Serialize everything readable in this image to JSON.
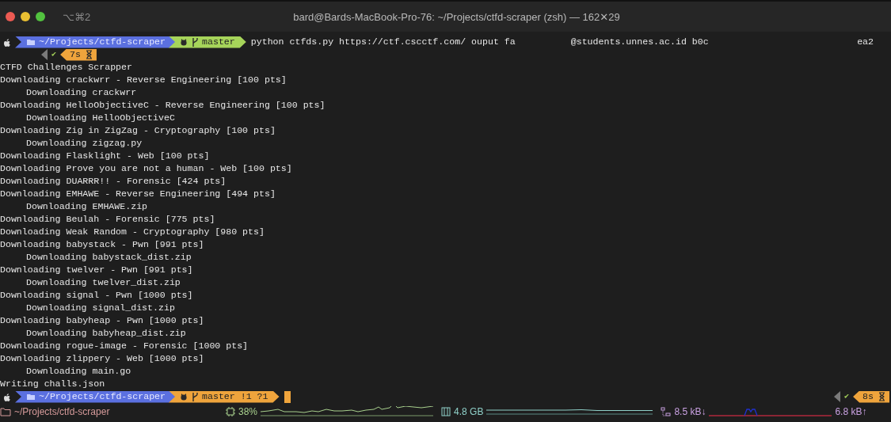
{
  "window": {
    "title": "bard@Bards-MacBook-Pro-76: ~/Projects/ctfd-scraper (zsh) — 162✕29",
    "shortcut": "⌥⌘2"
  },
  "prompt": {
    "path": "~/Projects/ctfd-scraper",
    "branch": "master",
    "dirty": false,
    "command": [
      "python ctfds.py https://ctf.cscctf.com/ ouput fa",
      "@students.unnes.ac.id b0c",
      "ea2"
    ]
  },
  "right_prompt": {
    "status": "✔",
    "duration": "7s"
  },
  "output": [
    {
      "kind": "line",
      "text": "CTFD Challenges Scrapper"
    },
    {
      "kind": "line",
      "text": "Downloading crackwrr - Reverse Engineering [100 pts]"
    },
    {
      "kind": "file",
      "text": "Downloading crackwrr"
    },
    {
      "kind": "line",
      "text": "Downloading HelloObjectiveC - Reverse Engineering [100 pts]"
    },
    {
      "kind": "file",
      "text": "Downloading HelloObjectiveC"
    },
    {
      "kind": "line",
      "text": "Downloading Zig in ZigZag - Cryptography [100 pts]"
    },
    {
      "kind": "file",
      "text": "Downloading zigzag.py"
    },
    {
      "kind": "line",
      "text": "Downloading Flasklight - Web [100 pts]"
    },
    {
      "kind": "line",
      "text": "Downloading Prove you are not a human - Web [100 pts]"
    },
    {
      "kind": "line",
      "text": "Downloading DUARRR!! - Forensic [424 pts]"
    },
    {
      "kind": "line",
      "text": "Downloading EMHAWE - Reverse Engineering [494 pts]"
    },
    {
      "kind": "file",
      "text": "Downloading EMHAWE.zip"
    },
    {
      "kind": "line",
      "text": "Downloading Beulah - Forensic [775 pts]"
    },
    {
      "kind": "line",
      "text": "Downloading Weak Random - Cryptography [980 pts]"
    },
    {
      "kind": "line",
      "text": "Downloading babystack - Pwn [991 pts]"
    },
    {
      "kind": "file",
      "text": "Downloading babystack_dist.zip"
    },
    {
      "kind": "line",
      "text": "Downloading twelver - Pwn [991 pts]"
    },
    {
      "kind": "file",
      "text": "Downloading twelver_dist.zip"
    },
    {
      "kind": "line",
      "text": "Downloading signal - Pwn [1000 pts]"
    },
    {
      "kind": "file",
      "text": "Downloading signal_dist.zip"
    },
    {
      "kind": "line",
      "text": "Downloading babyheap - Pwn [1000 pts]"
    },
    {
      "kind": "file",
      "text": "Downloading babyheap_dist.zip"
    },
    {
      "kind": "line",
      "text": "Downloading rogue-image - Forensic [1000 pts]"
    },
    {
      "kind": "line",
      "text": "Downloading zlippery - Web [1000 pts]"
    },
    {
      "kind": "file",
      "text": "Downloading main.go"
    },
    {
      "kind": "line",
      "text": "Writing challs.json"
    }
  ],
  "final_prompt": {
    "path": "~/Projects/ctfd-scraper",
    "branch": "master !1 ?1",
    "dirty": true
  },
  "final_right_prompt": {
    "status": "✔",
    "duration": "8s"
  },
  "status_bar": {
    "cwd": "~/Projects/ctfd-scraper",
    "cpu": "38%",
    "memory": "4.8 GB",
    "net_down": "8.5 kB↓",
    "net_up": "6.8 kB↑"
  }
}
